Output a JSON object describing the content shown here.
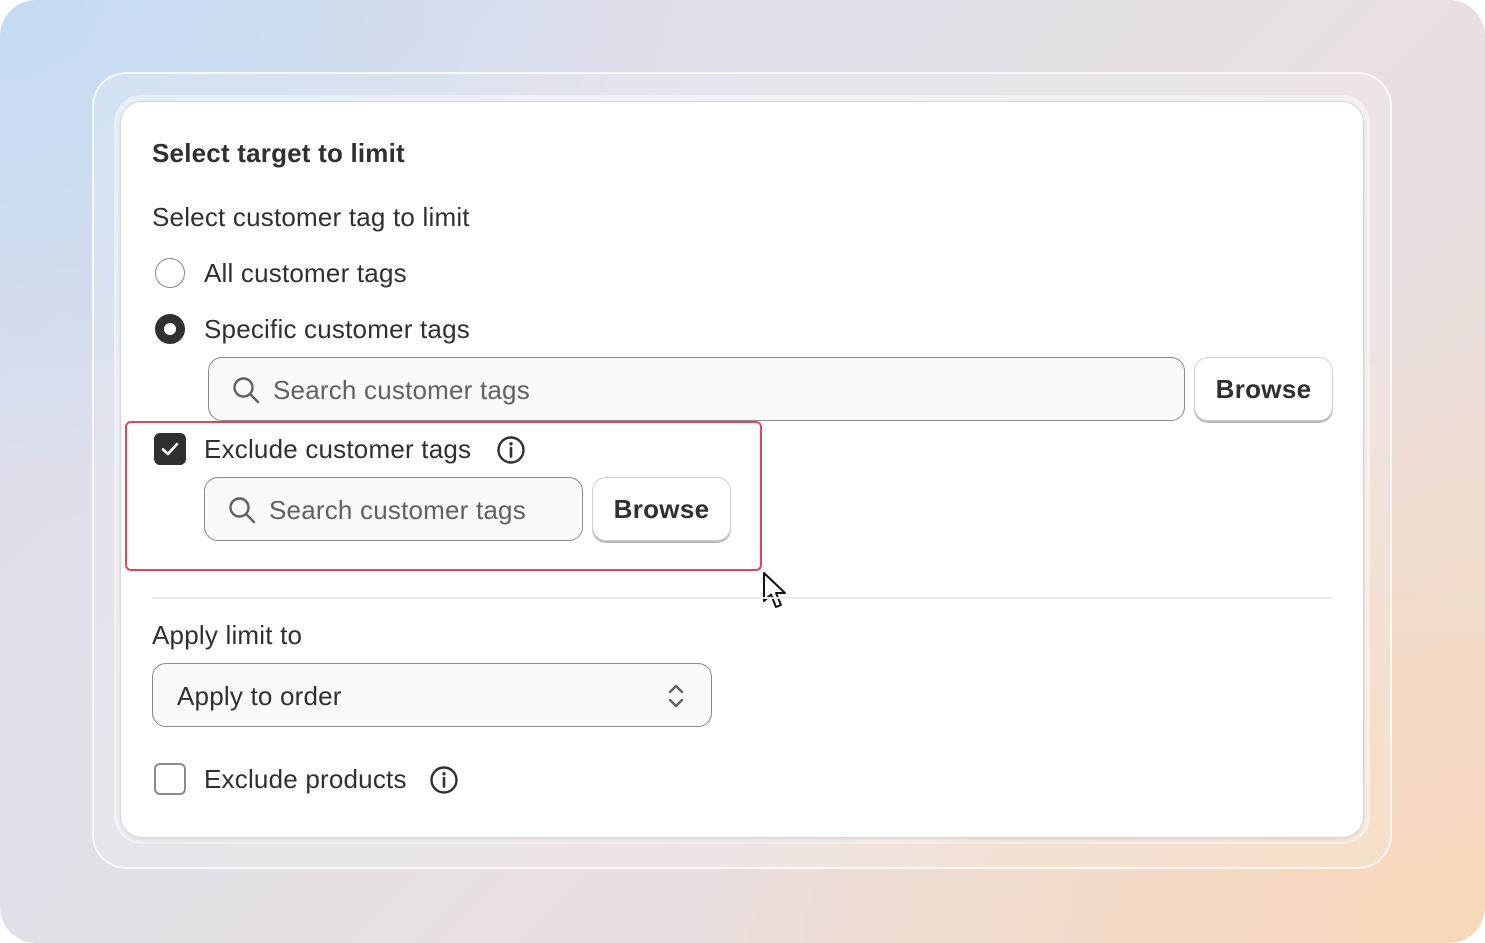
{
  "section_title": "Select target to limit",
  "customer_tag": {
    "label": "Select customer tag to limit",
    "options": [
      {
        "label": "All customer tags",
        "selected": false
      },
      {
        "label": "Specific customer tags",
        "selected": true
      }
    ],
    "search_placeholder": "Search customer tags",
    "browse_label": "Browse"
  },
  "exclude_tags": {
    "label": "Exclude customer tags",
    "checked": true,
    "info_icon": "info-icon",
    "search_placeholder": "Search customer tags",
    "browse_label": "Browse",
    "highlight_color": "#e2445c"
  },
  "apply_limit": {
    "label": "Apply limit to",
    "selected_value": "Apply to order"
  },
  "exclude_products": {
    "label": "Exclude products",
    "checked": false,
    "info_icon": "info-icon"
  },
  "colors": {
    "text": "#303030",
    "placeholder": "#616161",
    "border": "#8a8a8a"
  }
}
